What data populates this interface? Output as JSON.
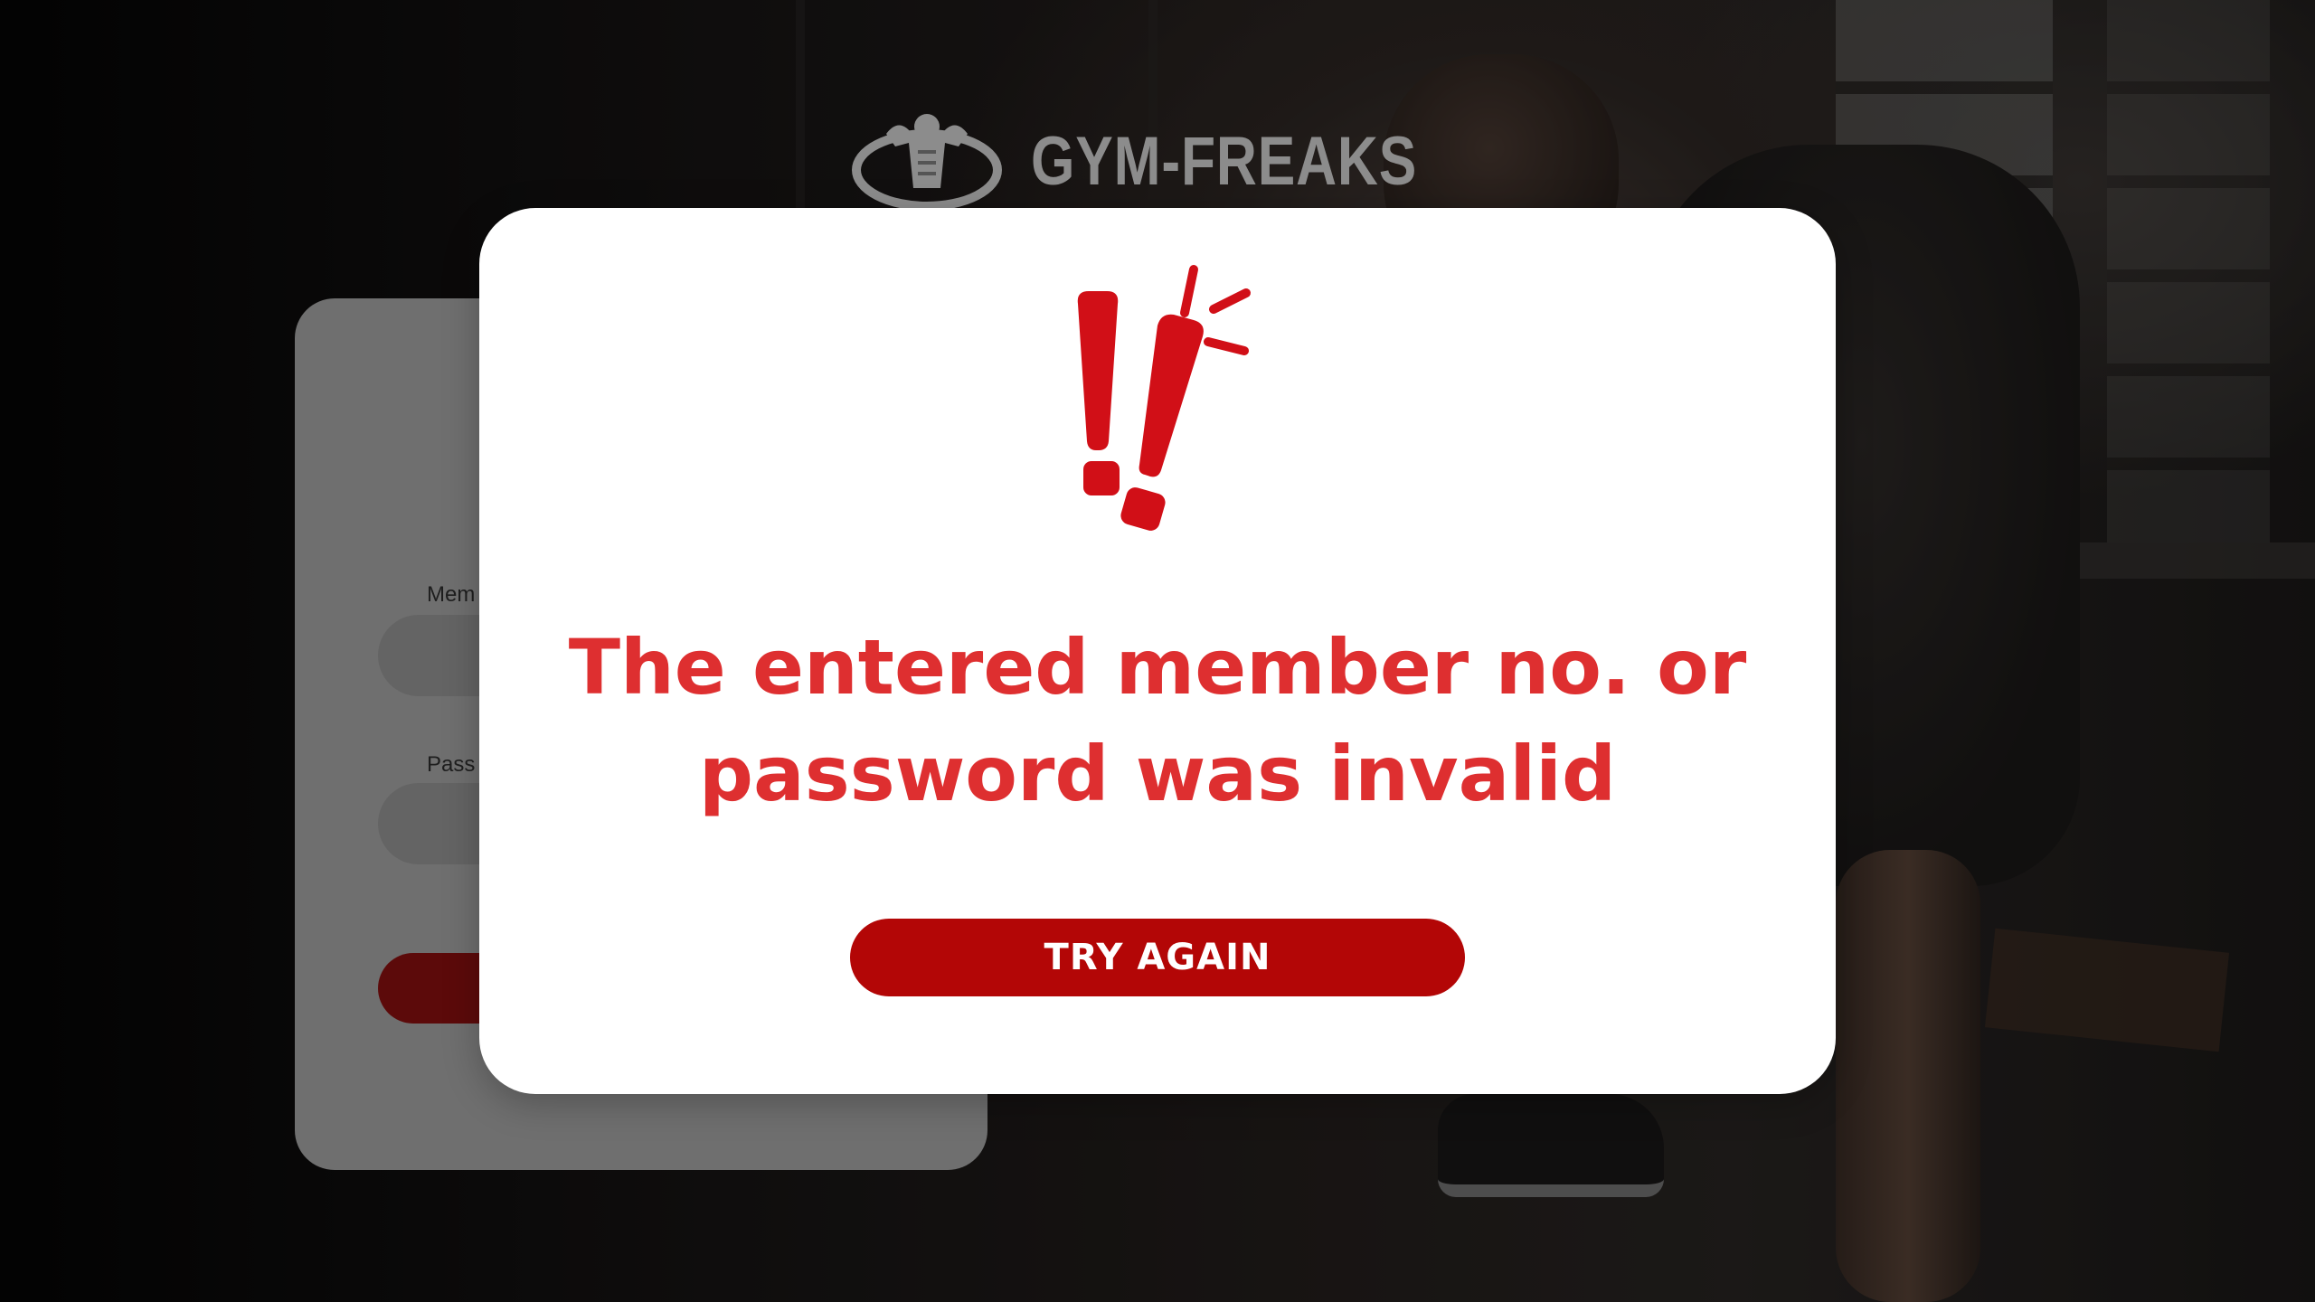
{
  "brand": {
    "name": "GYM-FREAKS"
  },
  "login": {
    "member_label": "Mem",
    "password_label": "Pass"
  },
  "error_modal": {
    "message_line1": "The entered member no. or",
    "message_line2": "password was invalid",
    "button_label": "TRY AGAIN"
  },
  "colors": {
    "accent_red": "#de2f30",
    "button_red": "#b30606",
    "modal_bg": "#ffffff"
  },
  "icons": {
    "alert": "exclamation-alert-icon",
    "logo": "bodybuilder-logo-icon"
  }
}
